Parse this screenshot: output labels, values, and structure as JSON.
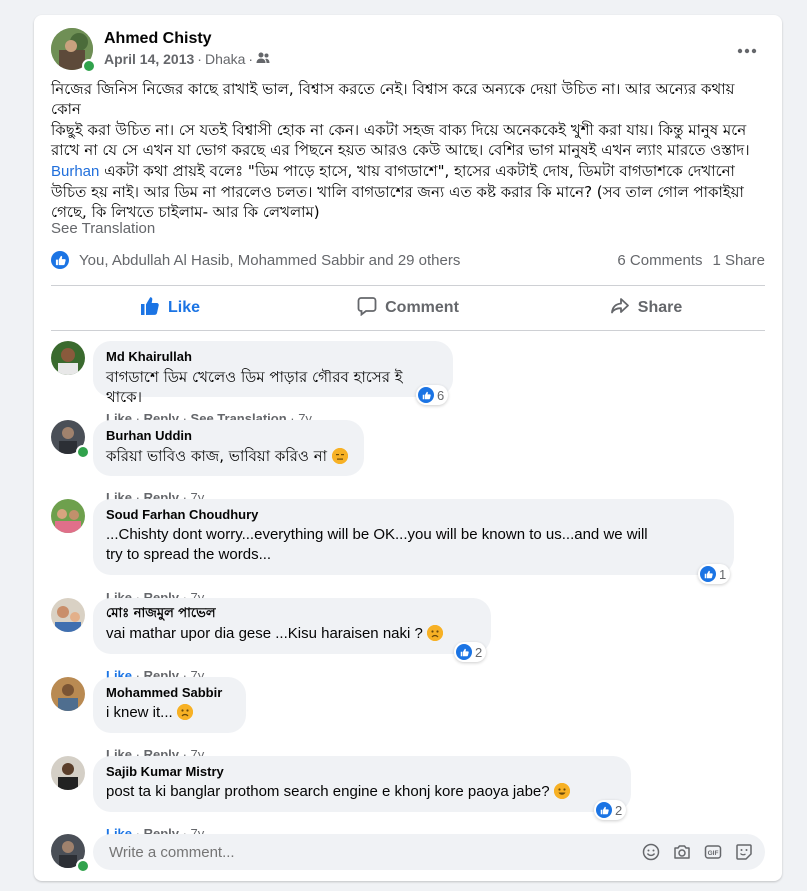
{
  "post": {
    "author": "Ahmed Chisty",
    "date": "April 14, 2013",
    "location": "Dhaka",
    "audience_icon": "friends-icon",
    "more_icon": "more-horizontal-icon",
    "text_lines": [
      "নিজের জিনিস নিজের কাছে রাখাই ভাল, বিশ্বাস করতে নেই। বিশ্বাস করে অন্যকে দেয়া উচিত না। আর অন্যের কথায় কোন",
      "কিছুই করা উচিত না। সে যতই বিশ্বাসী হোক না কেন। একটা সহজ বাক্য দিয়ে অনেককেই খুশী করা যায়। কিন্তু মানুষ মনে",
      "রাখে না যে সে এখন যা ভোগ করছে এর পিছনে হয়ত আরও কেউ আছে। বেশির ভাগ মানুষই এখন ল্যাং মারতে ওস্তাদ।"
    ],
    "mention": "Burhan",
    "text_after_mention": " একটা কথা প্রায়ই বলেঃ \"ডিম পাড়ে হাসে, খায় বাগডাশে\", হাসের একটাই দোষ, ডিমটা বাগডাশকে দেখানো",
    "text_tail_lines": [
      "উচিত হয় নাই। আর ডিম না পারলেও চলত। খালি বাগডাশের জন্য এত কষ্ট করার কি মানে? (সব তাল গোল পাকাইয়া",
      "গেছে, কি লিখতে চাইলাম- আর কি লেখলাম)"
    ],
    "see_translation": "See Translation",
    "reactions_text": "You, Abdullah Al Hasib, Mohammed Sabbir and 29 others",
    "comments_count": "6 Comments",
    "shares_count": "1 Share",
    "actions": {
      "like": "Like",
      "comment": "Comment",
      "share": "Share"
    }
  },
  "comments": [
    {
      "name": "Md Khairullah",
      "text": "বাগডাশে ডিম খেলেও ডিম পাড়ার গৌরব হাসের ই থাকে।",
      "like": "Like",
      "reply": "Reply",
      "translate": "See Translation",
      "time": "7y",
      "reactions": "6"
    },
    {
      "name": "Burhan Uddin",
      "text": "করিয়া ভাবিও কাজ, ভাবিয়া করিও না",
      "like": "Like",
      "reply": "Reply",
      "time": "7y"
    },
    {
      "name": "Soud Farhan Choudhury",
      "text_line1": "...Chishty dont worry...everything will be OK...you will be known to us...and we will",
      "text_line2": "try to spread the words...",
      "like": "Like",
      "reply": "Reply",
      "time": "7y",
      "reactions": "1"
    },
    {
      "name": "মোঃ নাজমুল পাভেল",
      "text": "vai mathar upor dia gese ...Kisu haraisen naki ?",
      "like": "Like",
      "reply": "Reply",
      "time": "7y",
      "reactions": "2"
    },
    {
      "name": "Mohammed Sabbir",
      "text": "i knew it...",
      "like": "Like",
      "reply": "Reply",
      "time": "7y"
    },
    {
      "name": "Sajib Kumar Mistry",
      "text": "post ta ki banglar prothom search engine e khonj kore paoya jabe?",
      "like": "Like",
      "reply": "Reply",
      "time": "7y",
      "reactions": "2"
    }
  ],
  "composer": {
    "placeholder": "Write a comment...",
    "icons": [
      "emoji-icon",
      "camera-icon",
      "gif-icon",
      "sticker-icon"
    ]
  },
  "colors": {
    "accent": "#1b74e4",
    "online": "#31a24c",
    "text_secondary": "#65676b"
  }
}
